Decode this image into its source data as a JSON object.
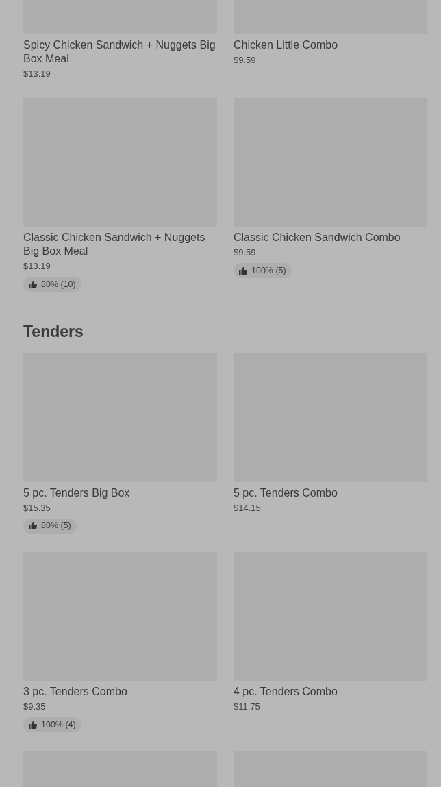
{
  "sections": [
    {
      "items": [
        {
          "kind": "top-cut",
          "name": "Spicy Chicken Sandwich + Nuggets Big Box Meal",
          "price": "$13.19"
        },
        {
          "kind": "top-cut",
          "name": "Chicken Little Combo",
          "price": "$9.59"
        },
        {
          "kind": "card",
          "name": "Classic Chicken Sandwich + Nuggets Big Box Meal",
          "price": "$13.19",
          "rating": "80% (10)"
        },
        {
          "kind": "card",
          "name": "Classic Chicken Sandwich Combo",
          "price": "$9.59",
          "rating": "100% (5)"
        }
      ]
    },
    {
      "title": "Tenders",
      "items": [
        {
          "kind": "card",
          "name": "5 pc. Tenders Big Box",
          "price": "$15.35",
          "rating": "80% (5)"
        },
        {
          "kind": "card",
          "name": "5 pc. Tenders Combo",
          "price": "$14.15"
        },
        {
          "kind": "card",
          "name": "3 pc. Tenders Combo",
          "price": "$9.35",
          "rating": "100% (4)"
        },
        {
          "kind": "card",
          "name": "4 pc. Tenders Combo",
          "price": "$11.75"
        },
        {
          "kind": "bottom-cut"
        },
        {
          "kind": "bottom-cut"
        }
      ]
    }
  ]
}
